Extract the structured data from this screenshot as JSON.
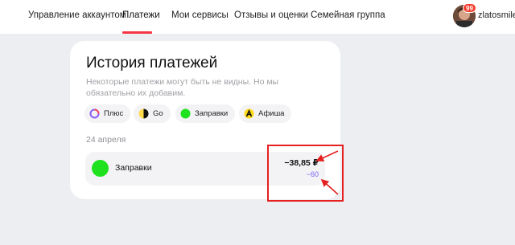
{
  "nav": {
    "items": [
      {
        "label": "Управление аккаунтом"
      },
      {
        "label": "Платежи"
      },
      {
        "label": "Мои сервисы"
      },
      {
        "label": "Отзывы и оценки"
      },
      {
        "label": "Семейная группа"
      }
    ],
    "active_index": 1
  },
  "user": {
    "name": "zlatosmile",
    "notification_count": "99"
  },
  "history": {
    "title": "История платежей",
    "subtitle": "Некоторые платежи могут быть не видны. Но мы обязательно их добавим.",
    "filters": [
      {
        "label": "Плюс",
        "icon": "plus-icon"
      },
      {
        "label": "Go",
        "icon": "go-icon"
      },
      {
        "label": "Заправки",
        "icon": "fuel-icon"
      },
      {
        "label": "Афиша",
        "icon": "afisha-icon"
      }
    ],
    "date": "24 апреля",
    "payment": {
      "name": "Заправки",
      "icon": "fuel-icon",
      "amount": "−38,85 ₽",
      "points": "−60",
      "points_color": "#7a5ef0"
    }
  },
  "colors": {
    "accent": "#f53543",
    "fuel_green": "#1de21d",
    "annotation_red": "#e62020"
  }
}
